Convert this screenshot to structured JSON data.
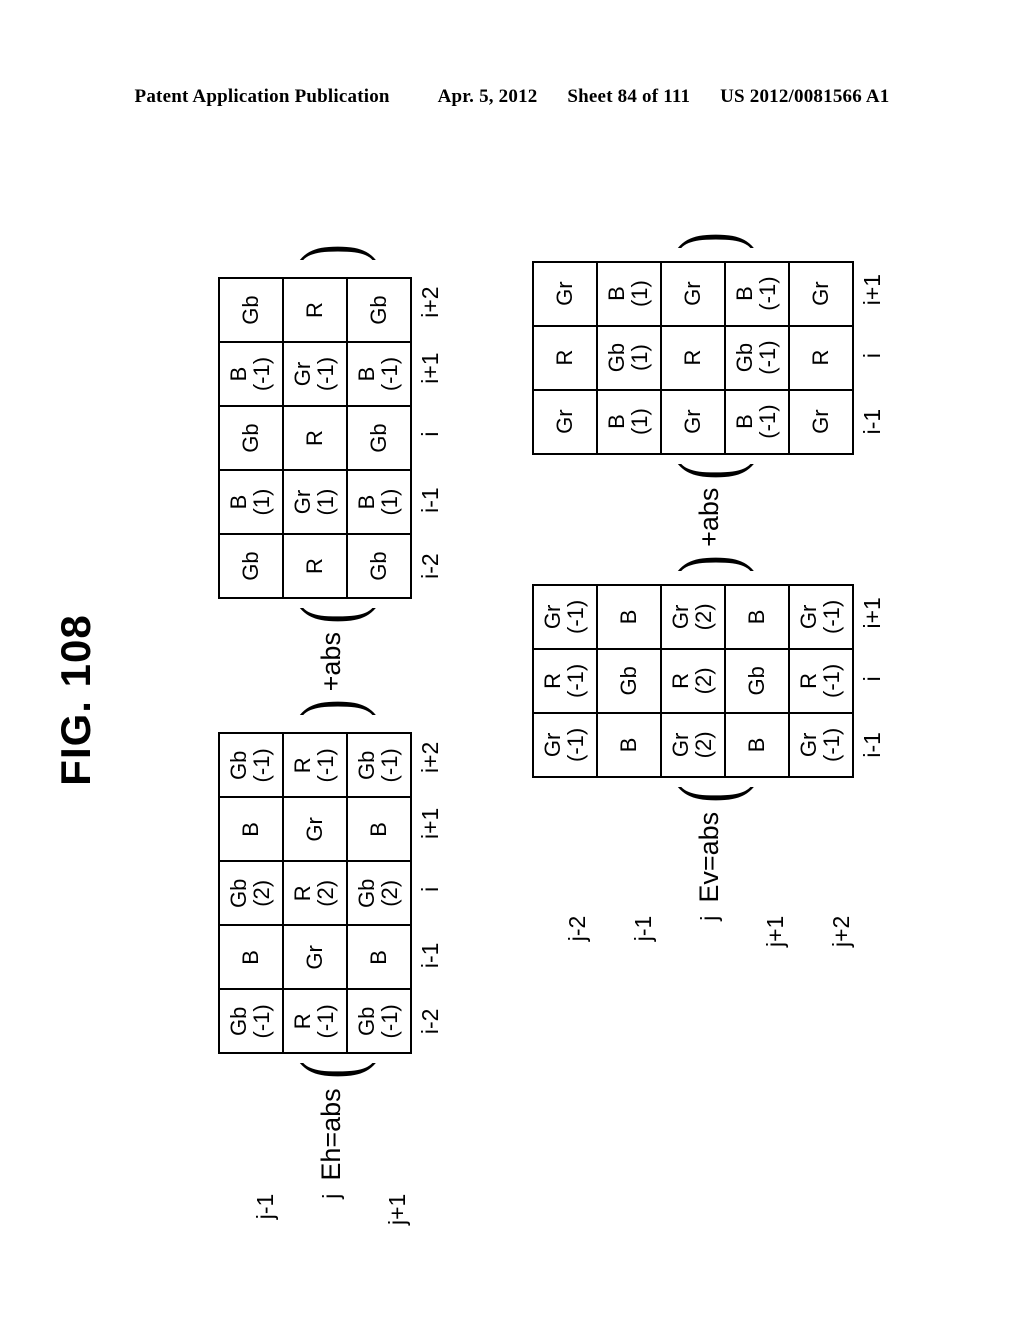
{
  "header": {
    "publication": "Patent Application Publication",
    "date": "Apr. 5, 2012",
    "sheet": "Sheet 84 of 111",
    "number": "US 2012/0081566 A1"
  },
  "figure": {
    "caption": "FIG. 108"
  },
  "equations": {
    "eh": {
      "label": "Eh=abs(",
      "connector": ")+abs(",
      "closing": ")",
      "row_labels": [
        "j-1",
        "j",
        "j+1"
      ],
      "col_labels": [
        "i-2",
        "i-1",
        "i",
        "i+1",
        "i+2"
      ],
      "grid1": [
        [
          {
            "v": "Gb",
            "w": "(-1)"
          },
          {
            "v": "B",
            "w": ""
          },
          {
            "v": "Gb",
            "w": "(2)"
          },
          {
            "v": "B",
            "w": ""
          },
          {
            "v": "Gb",
            "w": "(-1)"
          }
        ],
        [
          {
            "v": "R",
            "w": "(-1)"
          },
          {
            "v": "Gr",
            "w": ""
          },
          {
            "v": "R",
            "w": "(2)"
          },
          {
            "v": "Gr",
            "w": ""
          },
          {
            "v": "R",
            "w": "(-1)"
          }
        ],
        [
          {
            "v": "Gb",
            "w": "(-1)"
          },
          {
            "v": "B",
            "w": ""
          },
          {
            "v": "Gb",
            "w": "(2)"
          },
          {
            "v": "B",
            "w": ""
          },
          {
            "v": "Gb",
            "w": "(-1)"
          }
        ]
      ],
      "grid2": [
        [
          {
            "v": "Gb",
            "w": ""
          },
          {
            "v": "B",
            "w": "(1)"
          },
          {
            "v": "Gb",
            "w": ""
          },
          {
            "v": "B",
            "w": "(-1)"
          },
          {
            "v": "Gb",
            "w": ""
          }
        ],
        [
          {
            "v": "R",
            "w": ""
          },
          {
            "v": "Gr",
            "w": "(1)"
          },
          {
            "v": "R",
            "w": ""
          },
          {
            "v": "Gr",
            "w": "(-1)"
          },
          {
            "v": "R",
            "w": ""
          }
        ],
        [
          {
            "v": "Gb",
            "w": ""
          },
          {
            "v": "B",
            "w": "(1)"
          },
          {
            "v": "Gb",
            "w": ""
          },
          {
            "v": "B",
            "w": "(-1)"
          },
          {
            "v": "Gb",
            "w": ""
          }
        ]
      ]
    },
    "ev": {
      "label": "Ev=abs(",
      "connector": ")+abs(",
      "closing": ")",
      "row_labels": [
        "j-2",
        "j-1",
        "j",
        "j+1",
        "j+2"
      ],
      "col_labels": [
        "i-1",
        "i",
        "i+1"
      ],
      "grid1": [
        [
          {
            "v": "Gr",
            "w": "(-1)"
          },
          {
            "v": "R",
            "w": "(-1)"
          },
          {
            "v": "Gr",
            "w": "(-1)"
          }
        ],
        [
          {
            "v": "B",
            "w": ""
          },
          {
            "v": "Gb",
            "w": ""
          },
          {
            "v": "B",
            "w": ""
          }
        ],
        [
          {
            "v": "Gr",
            "w": "(2)"
          },
          {
            "v": "R",
            "w": "(2)"
          },
          {
            "v": "Gr",
            "w": "(2)"
          }
        ],
        [
          {
            "v": "B",
            "w": ""
          },
          {
            "v": "Gb",
            "w": ""
          },
          {
            "v": "B",
            "w": ""
          }
        ],
        [
          {
            "v": "Gr",
            "w": "(-1)"
          },
          {
            "v": "R",
            "w": "(-1)"
          },
          {
            "v": "Gr",
            "w": "(-1)"
          }
        ]
      ],
      "grid2": [
        [
          {
            "v": "Gr",
            "w": ""
          },
          {
            "v": "R",
            "w": ""
          },
          {
            "v": "Gr",
            "w": ""
          }
        ],
        [
          {
            "v": "B",
            "w": "(1)"
          },
          {
            "v": "Gb",
            "w": "(1)"
          },
          {
            "v": "B",
            "w": "(1)"
          }
        ],
        [
          {
            "v": "Gr",
            "w": ""
          },
          {
            "v": "R",
            "w": ""
          },
          {
            "v": "Gr",
            "w": ""
          }
        ],
        [
          {
            "v": "B",
            "w": "(-1)"
          },
          {
            "v": "Gb",
            "w": "(-1)"
          },
          {
            "v": "B",
            "w": "(-1)"
          }
        ],
        [
          {
            "v": "Gr",
            "w": ""
          },
          {
            "v": "R",
            "w": ""
          },
          {
            "v": "Gr",
            "w": ""
          }
        ]
      ]
    }
  }
}
